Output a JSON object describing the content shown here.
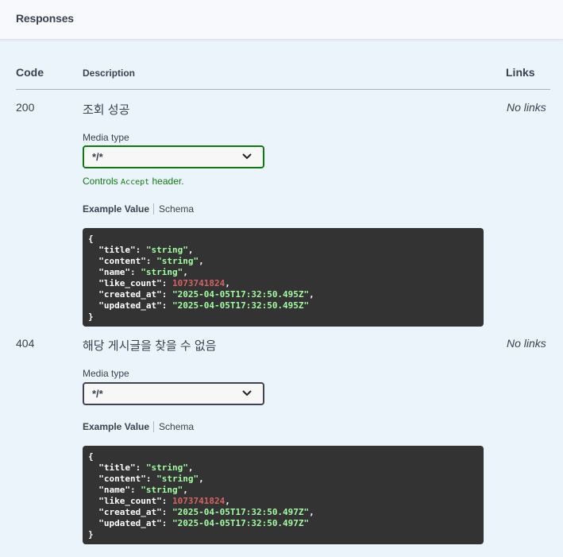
{
  "header": {
    "title": "Responses"
  },
  "columns": {
    "code": "Code",
    "description": "Description",
    "links": "Links"
  },
  "responses": [
    {
      "code": "200",
      "description": "조회 성공",
      "links": "No links",
      "media_type_label": "Media type",
      "media_type_value": "*/*",
      "controls_prefix": "Controls",
      "controls_code": "Accept",
      "controls_suffix": "header.",
      "tab_example": "Example Value",
      "tab_schema": "Schema",
      "example": {
        "open": "{",
        "close": "}",
        "title_key": "\"title\"",
        "title_val": "\"string\"",
        "content_key": "\"content\"",
        "content_val": "\"string\"",
        "name_key": "\"name\"",
        "name_val": "\"string\"",
        "like_key": "\"like_count\"",
        "like_val": "1073741824",
        "created_key": "\"created_at\"",
        "created_val": "\"2025-04-05T17:32:50.495Z\"",
        "updated_key": "\"updated_at\"",
        "updated_val": "\"2025-04-05T17:32:50.495Z\""
      }
    },
    {
      "code": "404",
      "description": "해당 게시글을 찾을 수 없음",
      "links": "No links",
      "media_type_label": "Media type",
      "media_type_value": "*/*",
      "tab_example": "Example Value",
      "tab_schema": "Schema",
      "example": {
        "open": "{",
        "close": "}",
        "title_key": "\"title\"",
        "title_val": "\"string\"",
        "content_key": "\"content\"",
        "content_val": "\"string\"",
        "name_key": "\"name\"",
        "name_val": "\"string\"",
        "like_key": "\"like_count\"",
        "like_val": "1073741824",
        "created_key": "\"created_at\"",
        "created_val": "\"2025-04-05T17:32:50.497Z\"",
        "updated_key": "\"updated_at\"",
        "updated_val": "\"2025-04-05T17:32:50.497Z\""
      }
    }
  ],
  "icons": {
    "select_arrow": "chevron-down-icon"
  },
  "colors": {
    "active_border": "#0d7a0d",
    "code_bg": "#333333",
    "string": "#a2fca2",
    "number": "#d36363"
  }
}
